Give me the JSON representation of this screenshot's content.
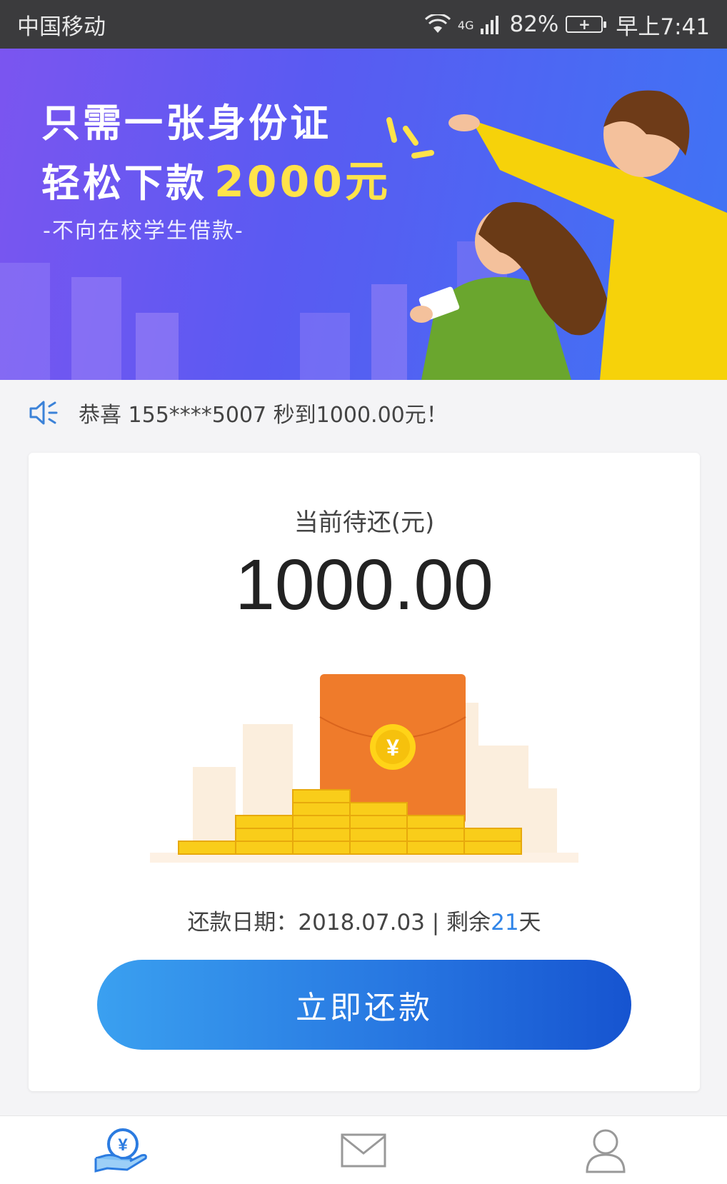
{
  "status_bar": {
    "carrier": "中国移动",
    "network": "4G",
    "battery": "82%",
    "time": "早上7:41"
  },
  "banner": {
    "line1": "只需一张身份证",
    "line2_prefix": "轻松下款",
    "line2_highlight": "2000元",
    "subtitle": "-不向在校学生借款-"
  },
  "notice": {
    "text": "恭喜 155****5007 秒到1000.00元！",
    "icon": "speaker-icon"
  },
  "card": {
    "label": "当前待还(元)",
    "amount": "1000.00",
    "due_prefix": "还款日期：2018.07.03 | 剩余",
    "due_days": "21",
    "due_suffix": "天",
    "pay_button": "立即还款",
    "red_envelope_symbol": "¥"
  },
  "tabs": [
    {
      "icon": "loan-hand-icon",
      "active": true
    },
    {
      "icon": "mail-icon",
      "active": false
    },
    {
      "icon": "user-icon",
      "active": false
    }
  ],
  "colors": {
    "accent": "#2f84e8",
    "banner_highlight": "#ffe34a",
    "button_start": "#3aa0f0",
    "button_end": "#1654d0"
  }
}
